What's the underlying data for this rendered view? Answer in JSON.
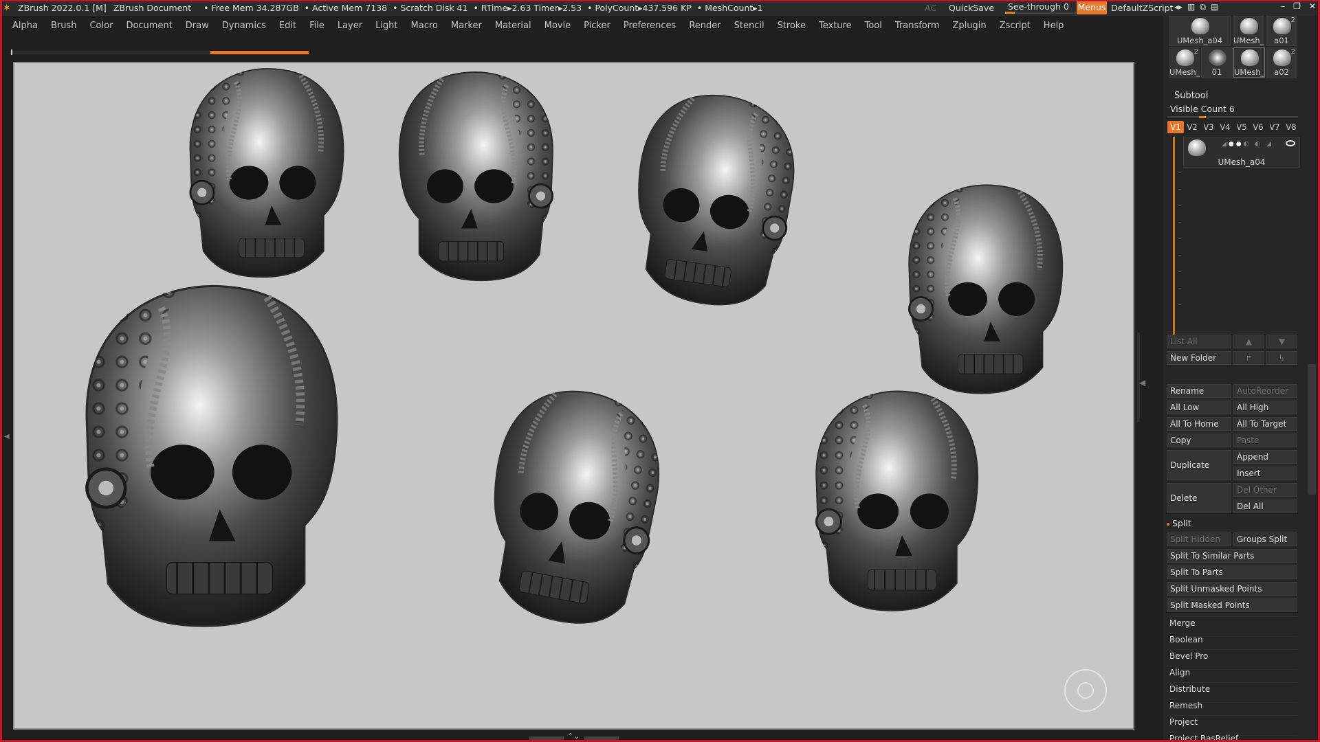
{
  "titlebar": {
    "app": "ZBrush 2022.0.1 [M]",
    "document": "ZBrush Document",
    "free_mem": "• Free Mem 34.287GB",
    "active_mem": "• Active Mem 7138",
    "scratch": "• Scratch Disk 41",
    "rtime": "• RTime▸2.63 Timer▸2.53",
    "polycount": "• PolyCount▸437.596 KP",
    "meshcount": "• MeshCount▸1",
    "ac": "AC",
    "quicksave": "QuickSave",
    "seethrough_label": "See-through",
    "seethrough_value": "0",
    "menus": "Menus",
    "script": "DefaultZScript"
  },
  "menubar": [
    "Alpha",
    "Brush",
    "Color",
    "Document",
    "Draw",
    "Dynamics",
    "Edit",
    "File",
    "Layer",
    "Light",
    "Macro",
    "Marker",
    "Material",
    "Movie",
    "Picker",
    "Preferences",
    "Render",
    "Stencil",
    "Stroke",
    "Texture",
    "Tool",
    "Transform",
    "Zplugin",
    "Zscript",
    "Help"
  ],
  "tool_thumbs": [
    {
      "name": "UMesh_a04",
      "num": ""
    },
    {
      "name": "UMesh_",
      "num": ""
    },
    {
      "name": "a01",
      "num": "2"
    },
    {
      "name": "UMesh_",
      "num": "2"
    },
    {
      "name": "01",
      "num": ""
    },
    {
      "name": "UMesh_",
      "num": ""
    },
    {
      "name": "a02",
      "num": "2"
    }
  ],
  "subtool": {
    "title": "Subtool",
    "visible_count": "Visible Count 6",
    "visible_count_value": 6,
    "versions": [
      "V1",
      "V2",
      "V3",
      "V4",
      "V5",
      "V6",
      "V7",
      "V8"
    ],
    "active_version": "V1",
    "item_name": "UMesh_a04"
  },
  "buttons": {
    "list_all": "List All",
    "new_folder": "New Folder",
    "rename": "Rename",
    "autoreorder": "AutoReorder",
    "all_low": "All Low",
    "all_high": "All High",
    "all_to_home": "All To Home",
    "all_to_target": "All To Target",
    "copy": "Copy",
    "paste": "Paste",
    "duplicate": "Duplicate",
    "append": "Append",
    "insert": "Insert",
    "delete": "Delete",
    "del_other": "Del Other",
    "del_all": "Del All"
  },
  "split": {
    "title": "Split",
    "split_hidden": "Split Hidden",
    "groups_split": "Groups Split",
    "similar": "Split To Similar Parts",
    "parts": "Split To Parts",
    "unmasked": "Split Unmasked Points",
    "masked": "Split Masked Points"
  },
  "sections": [
    "Merge",
    "Boolean",
    "Bevel Pro",
    "Align",
    "Distribute",
    "Remesh",
    "Project",
    "Project BasRelief"
  ],
  "colors": {
    "accent": "#e8772e",
    "frame": "#c8142b",
    "canvas": "#c7c7c7"
  }
}
